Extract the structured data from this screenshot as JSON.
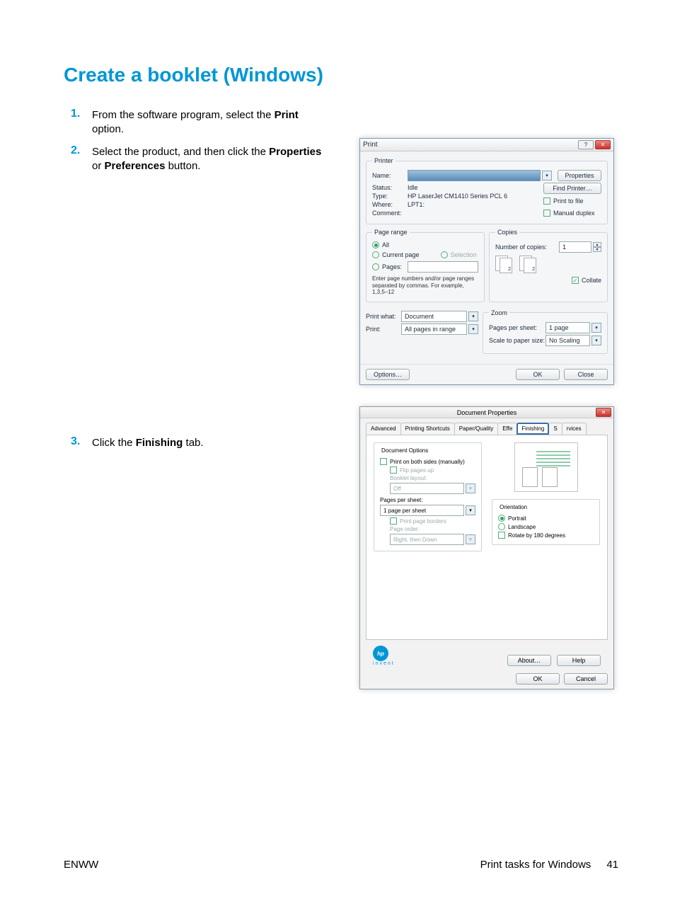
{
  "heading": "Create a booklet (Windows)",
  "steps": {
    "s1": {
      "num": "1.",
      "pre": "From the software program, select the ",
      "bold": "Print",
      "post": " option."
    },
    "s2": {
      "num": "2.",
      "pre": "Select the product, and then click the ",
      "b1": "Properties",
      "mid": " or ",
      "b2": "Preferences",
      "post": " button."
    },
    "s3": {
      "num": "3.",
      "pre": "Click the ",
      "bold": "Finishing",
      "post": " tab."
    }
  },
  "print_dialog": {
    "title": "Print",
    "printer_legend": "Printer",
    "name_lbl": "Name:",
    "status_lbl": "Status:",
    "status_val": "Idle",
    "type_lbl": "Type:",
    "type_val": "HP LaserJet CM1410 Series PCL 6",
    "where_lbl": "Where:",
    "where_val": "LPT1:",
    "comment_lbl": "Comment:",
    "properties_btn": "Properties",
    "find_btn": "Find Printer…",
    "print_to_file": "Print to file",
    "manual_duplex": "Manual duplex",
    "range_legend": "Page range",
    "range_all": "All",
    "range_current": "Current page",
    "range_selection": "Selection",
    "range_pages": "Pages:",
    "range_note": "Enter page numbers and/or page ranges separated by commas.  For example, 1,3,5–12",
    "copies_legend": "Copies",
    "num_copies_lbl": "Number of copies:",
    "num_copies_val": "1",
    "collate": "Collate",
    "print_what_lbl": "Print what:",
    "print_what_val": "Document",
    "print_lbl": "Print:",
    "print_val": "All pages in range",
    "zoom_legend": "Zoom",
    "pps_lbl": "Pages per sheet:",
    "pps_val": "1 page",
    "scale_lbl": "Scale to paper size:",
    "scale_val": "No Scaling",
    "options_btn": "Options…",
    "ok_btn": "OK",
    "close_btn": "Close"
  },
  "props_dialog": {
    "title": "Document Properties",
    "tabs": [
      "Advanced",
      "Printing Shortcuts",
      "Paper/Quality",
      "Effe",
      "Finishing",
      "S",
      "rvices"
    ],
    "doc_opts_legend": "Document Options",
    "print_both": "Print on both sides (manually)",
    "flip_up": "Flip pages up",
    "booklet_lbl": "Booklet layout:",
    "booklet_val": "Off",
    "pps_lbl": "Pages per sheet:",
    "pps_val": "1 page per sheet",
    "borders": "Print page borders",
    "order_lbl": "Page order:",
    "order_val": "Right, then Down",
    "orient_legend": "Orientation",
    "portrait": "Portrait",
    "landscape": "Landscape",
    "rotate": "Rotate by 180 degrees",
    "about_btn": "About…",
    "help_btn": "Help",
    "ok_btn": "OK",
    "cancel_btn": "Cancel",
    "invent": "invent"
  },
  "footer": {
    "left": "ENWW",
    "right": "Print tasks for Windows",
    "page": "41"
  }
}
